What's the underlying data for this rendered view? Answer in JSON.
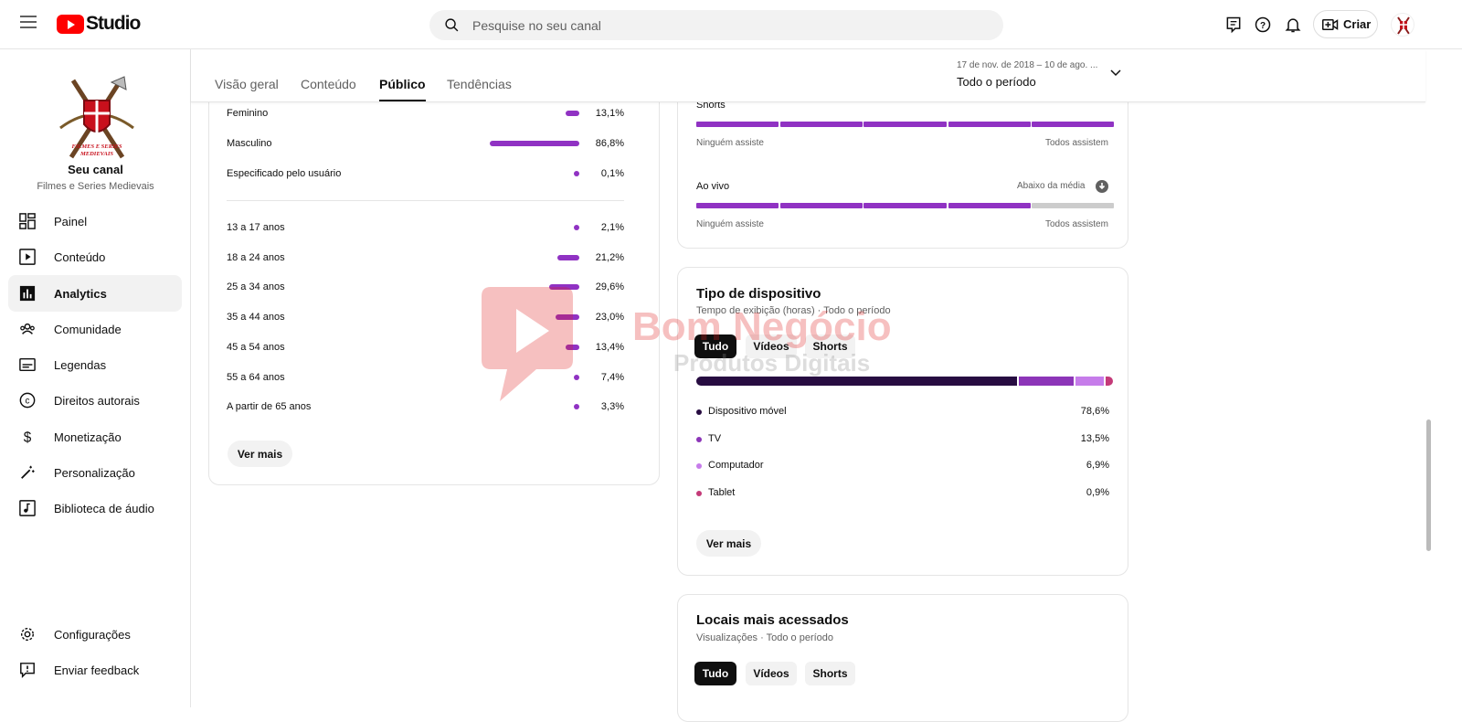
{
  "topbar": {
    "logo_text": "Studio",
    "search_placeholder": "Pesquise no seu canal",
    "create_label": "Criar"
  },
  "sidebar": {
    "channel_name": "Seu canal",
    "channel_sub": "Filmes e Series Medievais",
    "channel_logo_text": "FILMES E SERIES MEDIEVAIS",
    "items": [
      {
        "label": "Painel",
        "icon": "dashboard-icon"
      },
      {
        "label": "Conteúdo",
        "icon": "content-icon"
      },
      {
        "label": "Analytics",
        "icon": "analytics-icon"
      },
      {
        "label": "Comunidade",
        "icon": "community-icon"
      },
      {
        "label": "Legendas",
        "icon": "subtitles-icon"
      },
      {
        "label": "Direitos autorais",
        "icon": "copyright-icon"
      },
      {
        "label": "Monetização",
        "icon": "dollar-icon"
      },
      {
        "label": "Personalização",
        "icon": "magic-wand-icon"
      },
      {
        "label": "Biblioteca de áudio",
        "icon": "audio-library-icon"
      }
    ],
    "bottom": [
      {
        "label": "Configurações",
        "icon": "gear-icon"
      },
      {
        "label": "Enviar feedback",
        "icon": "feedback-icon"
      }
    ]
  },
  "tabs": [
    "Visão geral",
    "Conteúdo",
    "Público",
    "Tendências"
  ],
  "date": {
    "range": "17 de nov. de 2018 – 10 de ago. ...",
    "period": "Todo o período"
  },
  "demographics": {
    "gender": [
      {
        "label": "Feminino",
        "value": "13,1%",
        "pct": 13.1
      },
      {
        "label": "Masculino",
        "value": "86,8%",
        "pct": 86.8
      },
      {
        "label": "Especificado pelo usuário",
        "value": "0,1%",
        "pct": 0.1
      }
    ],
    "age": [
      {
        "label": "13 a 17 anos",
        "value": "2,1%",
        "pct": 2.1
      },
      {
        "label": "18 a 24 anos",
        "value": "21,2%",
        "pct": 21.2
      },
      {
        "label": "25 a 34 anos",
        "value": "29,6%",
        "pct": 29.6
      },
      {
        "label": "35 a 44 anos",
        "value": "23,0%",
        "pct": 23.0
      },
      {
        "label": "45 a 54 anos",
        "value": "13,4%",
        "pct": 13.4
      },
      {
        "label": "55 a 64 anos",
        "value": "7,4%",
        "pct": 7.4
      },
      {
        "label": "A partir de 65 anos",
        "value": "3,3%",
        "pct": 3.3
      }
    ],
    "more_button": "Ver mais"
  },
  "viewing": {
    "shorts_label": "Shorts",
    "shorts_filled": 5,
    "live_label": "Ao vivo",
    "live_filled": 4,
    "live_note": "Abaixo da média",
    "min_label": "Ninguém assiste",
    "max_label": "Todos assistem"
  },
  "device": {
    "title": "Tipo de dispositivo",
    "subtitle": "Tempo de exibição (horas) · Todo o período",
    "chips": [
      "Tudo",
      "Vídeos",
      "Shorts"
    ],
    "items": [
      {
        "label": "Dispositivo móvel",
        "value": "78,6%",
        "pct": 78.6,
        "color": "#270c41"
      },
      {
        "label": "TV",
        "value": "13,5%",
        "pct": 13.5,
        "color": "#8c35b8"
      },
      {
        "label": "Computador",
        "value": "6,9%",
        "pct": 6.9,
        "color": "#c67cea"
      },
      {
        "label": "Tablet",
        "value": "0,9%",
        "pct": 0.9,
        "color": "#c43a78"
      }
    ],
    "more_button": "Ver mais"
  },
  "locations": {
    "title": "Locais mais acessados",
    "subtitle": "Visualizações · Todo o período",
    "chips": [
      "Tudo",
      "Vídeos",
      "Shorts"
    ]
  },
  "watermark": {
    "line1": "Bom Negócio",
    "line2": "Produtos Digitais"
  },
  "colors": {
    "accent": "#9032c3",
    "brand": "#ff0000"
  }
}
